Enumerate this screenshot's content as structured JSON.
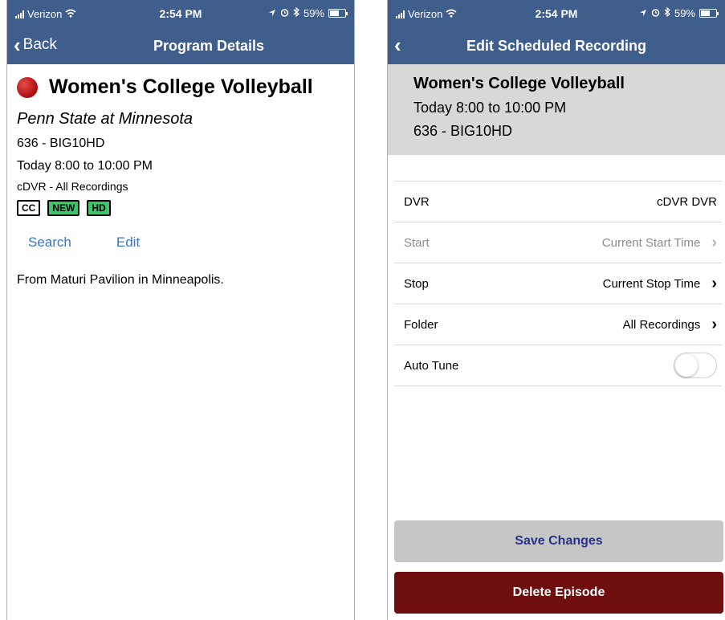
{
  "status_bar": {
    "carrier": "Verizon",
    "time": "2:54 PM",
    "battery": "59%",
    "battery_fraction": 0.59
  },
  "left_screen": {
    "nav": {
      "back_label": "Back",
      "title": "Program Details"
    },
    "program": {
      "title": "Women's College Volleyball",
      "episode": "Penn State at Minnesota",
      "channel": "636 - BIG10HD",
      "time": "Today 8:00 to 10:00 PM",
      "recording_info": "cDVR - All Recordings",
      "badges": [
        "CC",
        "NEW",
        "HD"
      ],
      "description": "From Maturi Pavilion in Minneapolis."
    },
    "links": {
      "search": "Search",
      "edit": "Edit"
    }
  },
  "right_screen": {
    "nav": {
      "title": "Edit Scheduled Recording"
    },
    "summary": {
      "title": "Women's College Volleyball",
      "time": "Today 8:00 to 10:00 PM",
      "channel": "636 - BIG10HD"
    },
    "rows": {
      "dvr": {
        "label": "DVR",
        "value": "cDVR DVR"
      },
      "start": {
        "label": "Start",
        "value": "Current Start Time"
      },
      "stop": {
        "label": "Stop",
        "value": "Current Stop Time"
      },
      "folder": {
        "label": "Folder",
        "value": "All Recordings"
      },
      "auto_tune": {
        "label": "Auto Tune",
        "enabled": false
      }
    },
    "buttons": {
      "save": "Save Changes",
      "delete": "Delete Episode"
    }
  },
  "icons": {
    "signal": "signal-icon",
    "wifi": "wifi-icon",
    "location": "location-icon",
    "alarm": "alarm-icon",
    "bluetooth": "bluetooth-icon",
    "battery": "battery-icon",
    "back": "chevron-left-icon",
    "record": "record-icon",
    "chevron": "chevron-right-icon"
  },
  "colors": {
    "nav_bar": "#3f5e8c",
    "link": "#3a78c8",
    "summary_bg": "#d8d8d8",
    "save_bg": "#c6c6c6",
    "save_text": "#28328c",
    "delete_bg": "#6e0e0e",
    "badge_green": "#3ec46a"
  }
}
